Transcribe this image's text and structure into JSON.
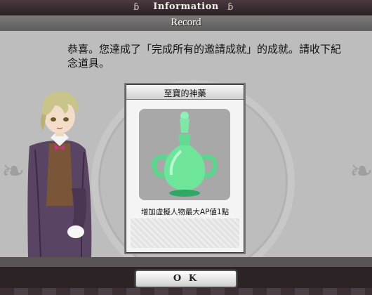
{
  "window": {
    "title": "Information",
    "ornament_glyph": "ɓ"
  },
  "header": {
    "title": "Record"
  },
  "message": {
    "text": "恭喜。您達成了「完成所有的邀請成就」的成就。請收下紀念道具。"
  },
  "item": {
    "name": "至寶的神藥",
    "description": "增加虛擬人物最大AP値1點",
    "icon": "green-potion-icon",
    "colors": {
      "potion": "#6fe59a",
      "potion_dark": "#2ea863"
    }
  },
  "actions": {
    "ok_label": "O K"
  }
}
